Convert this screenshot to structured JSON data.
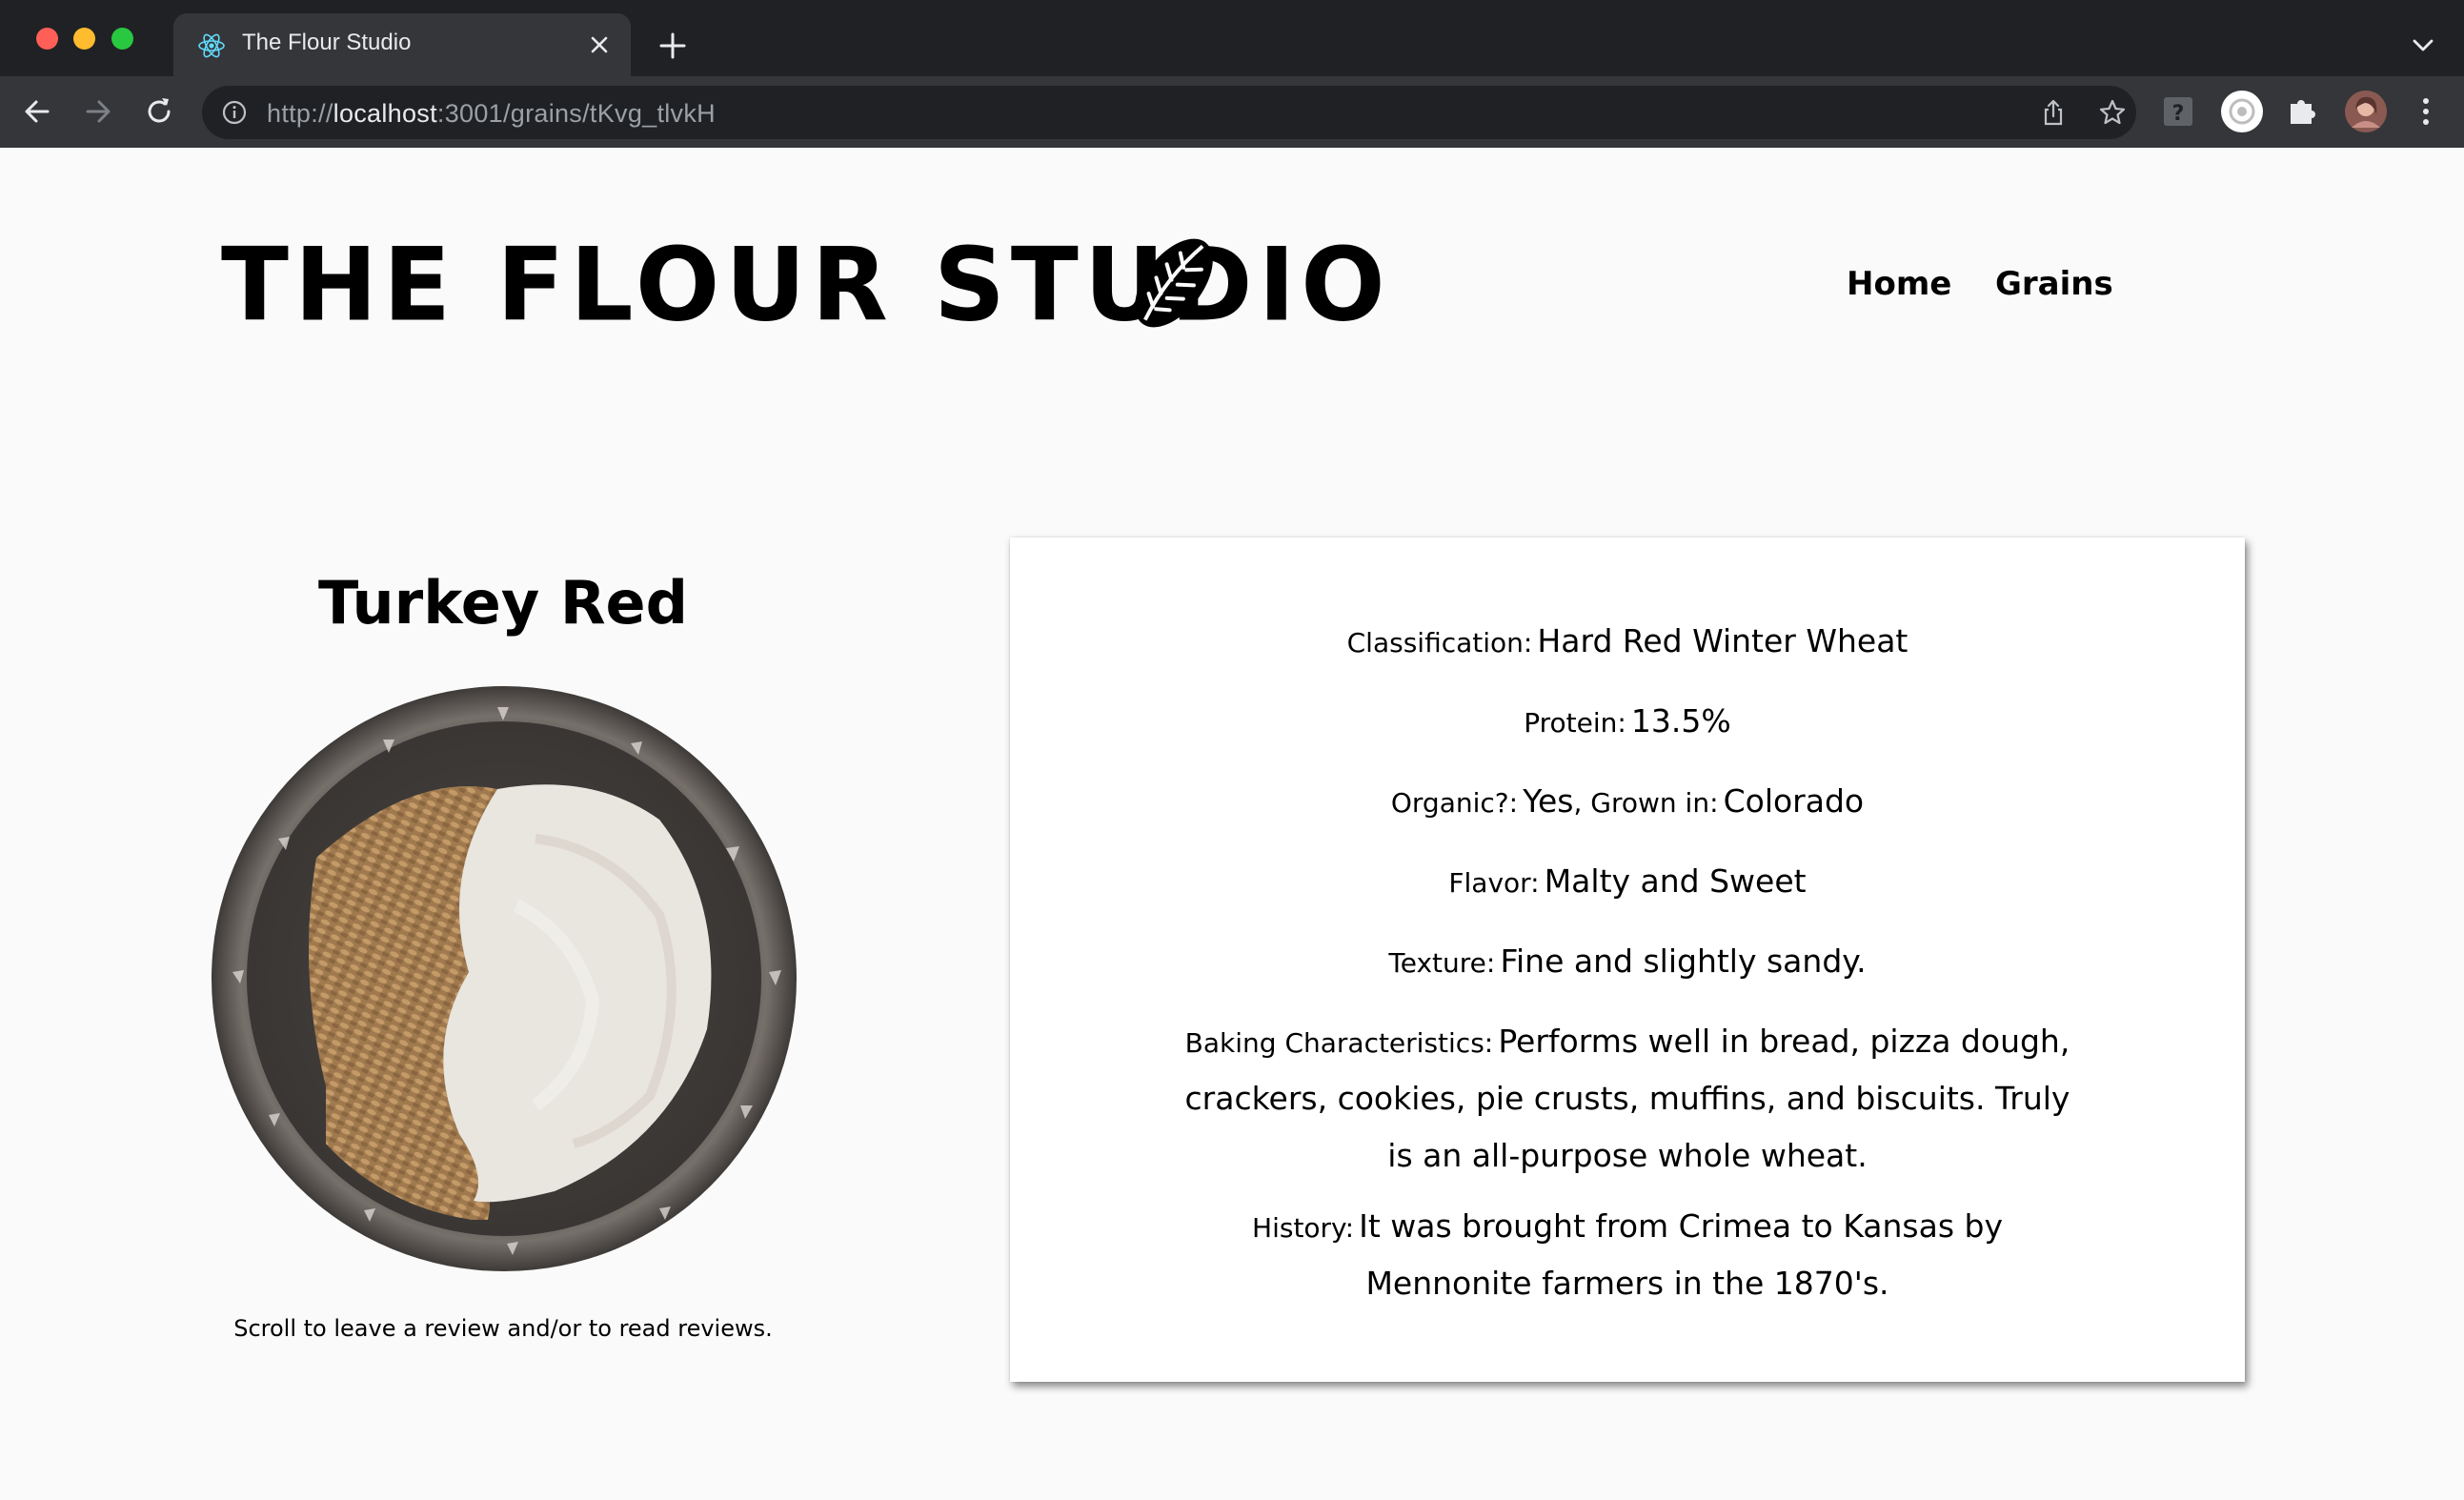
{
  "browser": {
    "tab_title": "The Flour Studio",
    "url_scheme": "http://",
    "url_host": "localhost",
    "url_path": ":3001/grains/tKvg_tlvkH"
  },
  "site": {
    "logo_text": "THE FLOUR STUDIO",
    "nav": {
      "home": "Home",
      "grains": "Grains"
    }
  },
  "grain": {
    "name": "Turkey Red",
    "scroll_hint": "Scroll to leave a review and/or to read reviews.",
    "details": {
      "classification_label": "Classification:",
      "classification": "Hard Red Winter Wheat",
      "protein_label": "Protein:",
      "protein": "13.5%",
      "organic_label": "Organic?:",
      "organic": "Yes",
      "grown_label": ", Grown in:",
      "grown": "Colorado",
      "flavor_label": "Flavor:",
      "flavor": "Malty and Sweet",
      "texture_label": "Texture:",
      "texture": "Fine and slightly sandy.",
      "baking_label": "Baking Characteristics:",
      "baking": "Performs well in bread, pizza dough, crackers, cookies, pie crusts, muffins, and biscuits. Truly is an all-purpose whole wheat.",
      "history_label": "History:",
      "history": "It was brought from Crimea to Kansas by Mennonite farmers in the 1870's."
    }
  }
}
